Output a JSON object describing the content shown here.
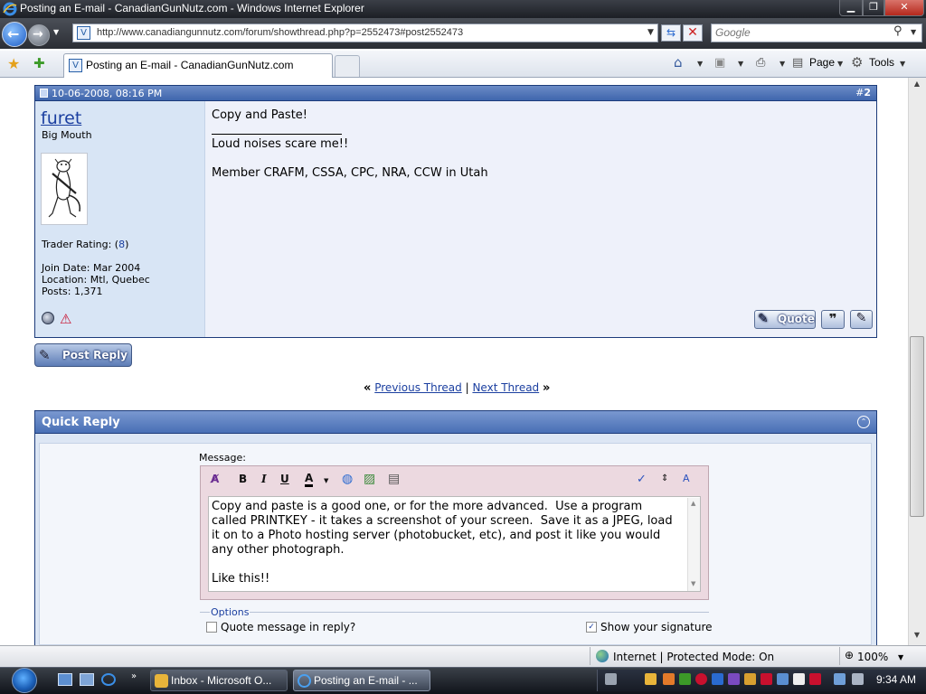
{
  "window": {
    "title": "Posting an E-mail - CanadianGunNutz.com - Windows Internet Explorer",
    "min_glyph": "▁",
    "max_glyph": "❐",
    "close_glyph": "✕"
  },
  "address_bar": {
    "url": "http://www.canadiangunnutz.com/forum/showthread.php?p=2552473#post2552473",
    "search_placeholder": "Google"
  },
  "tabs": {
    "active_label": "Posting an E-mail - CanadianGunNutz.com"
  },
  "command_bar": {
    "page_label": "Page",
    "tools_label": "Tools"
  },
  "post": {
    "date": "10-06-2008, 08:16 PM",
    "number_prefix": "#",
    "number": "2",
    "username": "furet",
    "user_title": "Big Mouth",
    "trader_rating_label": "Trader Rating: (",
    "trader_rating_value": "8",
    "trader_rating_close": ")",
    "join_date": "Join Date: Mar 2004",
    "location": "Location: Mtl, Quebec",
    "posts": "Posts: 1,371",
    "message": "Copy and Paste!",
    "signature_line1": "Loud noises scare me!!",
    "signature_line2": "Member CRAFM, CSSA, CPC, NRA, CCW in Utah",
    "quote_label": "Quote"
  },
  "post_reply_label": "Post Reply",
  "thread_nav": {
    "prev": "Previous Thread",
    "next": "Next Thread",
    "sep": "|",
    "left": "«",
    "right": "»"
  },
  "quick_reply": {
    "title": "Quick Reply",
    "message_label": "Message:",
    "message_text": "Copy and paste is a good one, or for the more advanced.  Use a program called PRINTKEY - it takes a screenshot of your screen.  Save it as a JPEG, load it on to a Photo hosting server (photobucket, etc), and post it like you would any other photograph.\n\nLike this!!",
    "options_label": "Options",
    "quote_in_reply_label": "Quote message in reply?",
    "quote_in_reply_checked": false,
    "show_signature_label": "Show your signature",
    "show_signature_checked": true
  },
  "status_bar": {
    "zone": "Internet | Protected Mode: On",
    "zoom": "100%"
  },
  "taskbar": {
    "items": [
      {
        "label": "Inbox - Microsoft O..."
      },
      {
        "label": "Posting an E-mail - ..."
      }
    ],
    "clock": "9:34 AM"
  },
  "colors": {
    "post_header": "#4a6fb0",
    "user_column": "#d8e5f5",
    "link": "#1b3fa0",
    "editor_frame": "#ecd9e0"
  }
}
